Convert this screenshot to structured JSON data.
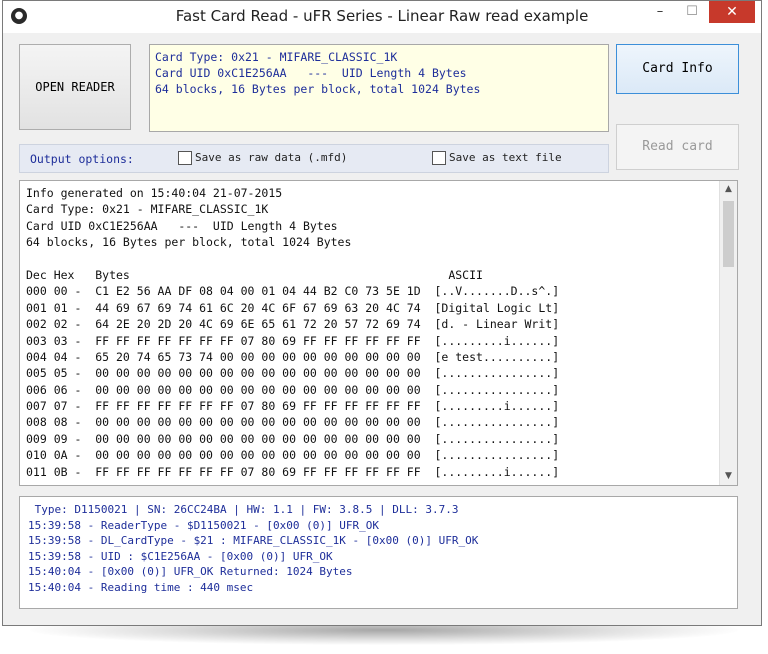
{
  "window": {
    "title": "Fast Card Read - uFR Series - Linear Raw read example",
    "icon": "app-icon",
    "controls": {
      "minimize": "–",
      "maximize": "☐",
      "close": "✕"
    }
  },
  "buttons": {
    "open_reader": "OPEN READER",
    "card_info": "Card Info",
    "read_card": "Read card"
  },
  "card_info_box": [
    "Card Type: 0x21 - MIFARE_CLASSIC_1K",
    "Card UID 0xC1E256AA   ---  UID Length 4 Bytes",
    "64 blocks, 16 Bytes per block, total 1024 Bytes"
  ],
  "output_options": {
    "label": "Output options:",
    "save_raw": {
      "label": "Save as raw data (.mfd)",
      "checked": false
    },
    "save_text": {
      "label": "Save as text file",
      "checked": false
    }
  },
  "output": {
    "lines": [
      "Info generated on 15:40:04 21-07-2015",
      "Card Type: 0x21 - MIFARE_CLASSIC_1K",
      "Card UID 0xC1E256AA   ---  UID Length 4 Bytes",
      "64 blocks, 16 Bytes per block, total 1024 Bytes",
      "",
      "Dec Hex   Bytes                                              ASCII",
      "000 00 -  C1 E2 56 AA DF 08 04 00 01 04 44 B2 C0 73 5E 1D  [..V.......D..s^.]",
      "001 01 -  44 69 67 69 74 61 6C 20 4C 6F 67 69 63 20 4C 74  [Digital Logic Lt]",
      "002 02 -  64 2E 20 2D 20 4C 69 6E 65 61 72 20 57 72 69 74  [d. - Linear Writ]",
      "003 03 -  FF FF FF FF FF FF FF 07 80 69 FF FF FF FF FF FF  [.........i......]",
      "004 04 -  65 20 74 65 73 74 00 00 00 00 00 00 00 00 00 00  [e test..........]",
      "005 05 -  00 00 00 00 00 00 00 00 00 00 00 00 00 00 00 00  [................]",
      "006 06 -  00 00 00 00 00 00 00 00 00 00 00 00 00 00 00 00  [................]",
      "007 07 -  FF FF FF FF FF FF FF 07 80 69 FF FF FF FF FF FF  [.........i......]",
      "008 08 -  00 00 00 00 00 00 00 00 00 00 00 00 00 00 00 00  [................]",
      "009 09 -  00 00 00 00 00 00 00 00 00 00 00 00 00 00 00 00  [................]",
      "010 0A -  00 00 00 00 00 00 00 00 00 00 00 00 00 00 00 00  [................]",
      "011 0B -  FF FF FF FF FF FF FF 07 80 69 FF FF FF FF FF FF  [.........i......]"
    ]
  },
  "log": {
    "lines": [
      " Type: D1150021 | SN: 26CC24BA | HW: 1.1 | FW: 3.8.5 | DLL: 3.7.3",
      "15:39:58 - ReaderType - $D1150021 - [0x00 (0)] UFR_OK",
      "15:39:58 - DL_CardType - $21 : MIFARE_CLASSIC_1K - [0x00 (0)] UFR_OK",
      "15:39:58 - UID : $C1E256AA - [0x00 (0)] UFR_OK",
      "15:40:04 - [0x00 (0)] UFR_OK Returned: 1024 Bytes",
      "15:40:04 - Reading time : 440 msec"
    ]
  },
  "colors": {
    "accent_text": "#1e2e9a",
    "card_box_bg": "#ffffe6",
    "close_button": "#c7392b",
    "focus_border": "#3c8fd9"
  }
}
